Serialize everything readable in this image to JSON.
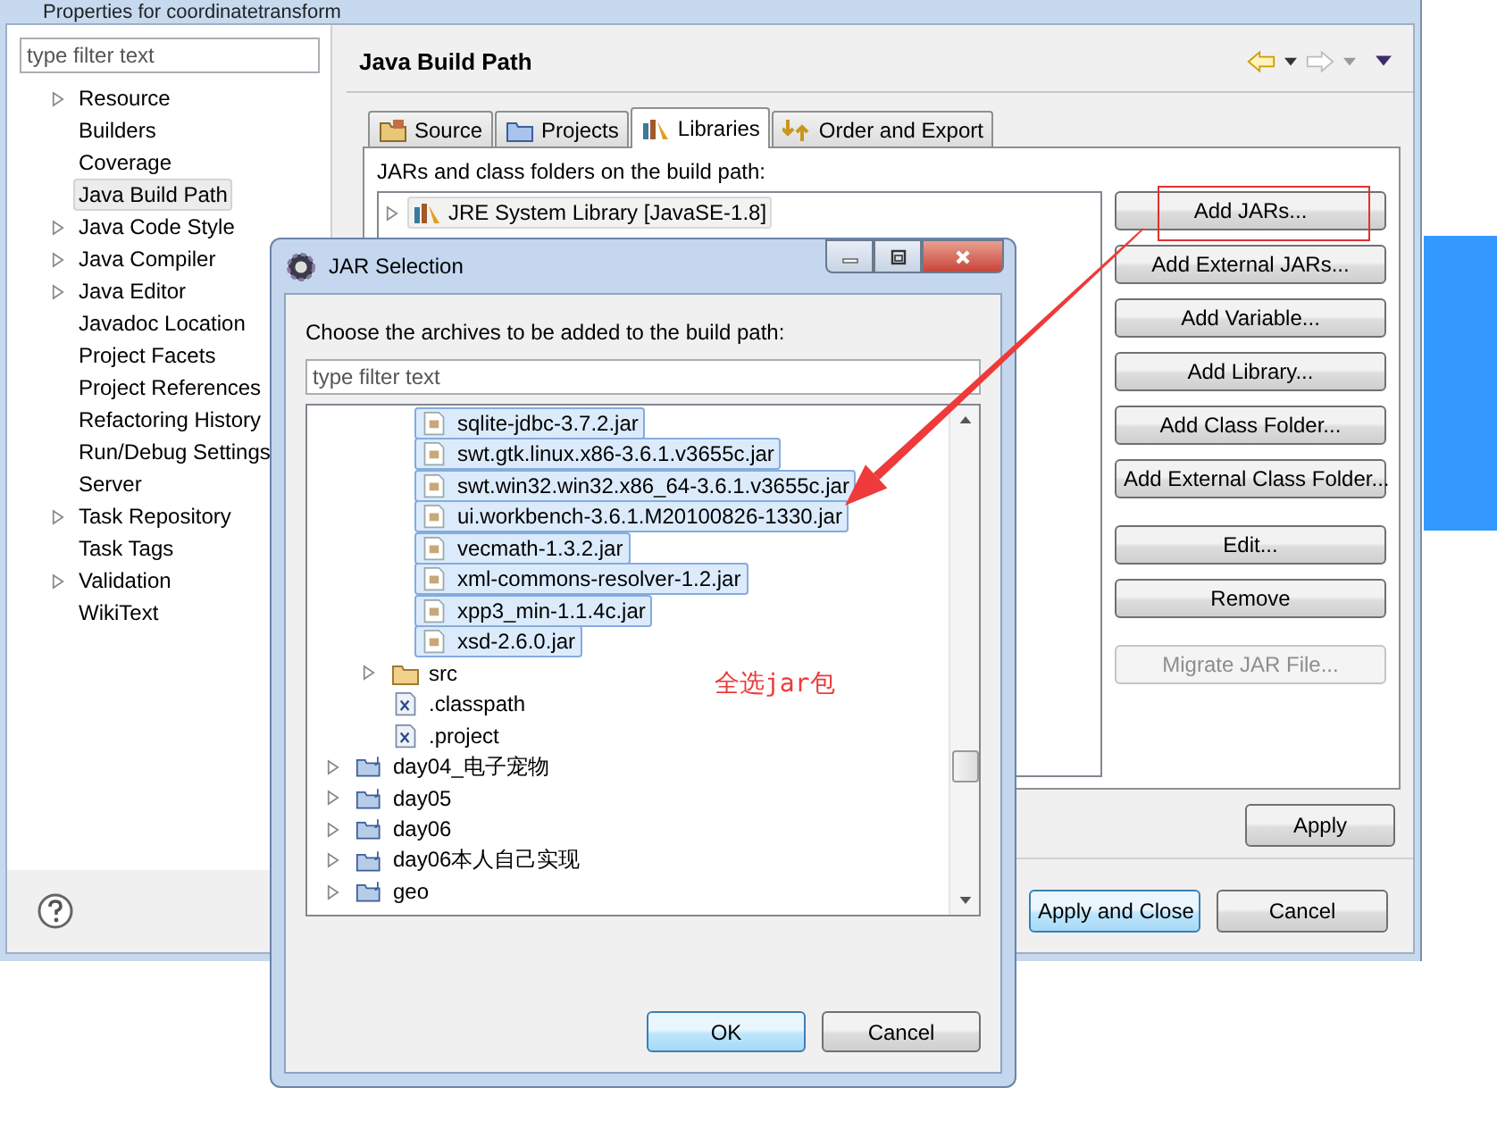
{
  "window": {
    "title": "Properties for coordinatetransform"
  },
  "sidebar": {
    "filter": {
      "placeholder": "type filter text"
    },
    "items": [
      {
        "label": "Resource",
        "expandable": true,
        "selected": false
      },
      {
        "label": "Builders",
        "expandable": false,
        "selected": false
      },
      {
        "label": "Coverage",
        "expandable": false,
        "selected": false
      },
      {
        "label": "Java Build Path",
        "expandable": false,
        "selected": true
      },
      {
        "label": "Java Code Style",
        "expandable": true,
        "selected": false
      },
      {
        "label": "Java Compiler",
        "expandable": true,
        "selected": false
      },
      {
        "label": "Java Editor",
        "expandable": true,
        "selected": false
      },
      {
        "label": "Javadoc Location",
        "expandable": false,
        "selected": false
      },
      {
        "label": "Project Facets",
        "expandable": false,
        "selected": false
      },
      {
        "label": "Project References",
        "expandable": false,
        "selected": false
      },
      {
        "label": "Refactoring History",
        "expandable": false,
        "selected": false
      },
      {
        "label": "Run/Debug Settings",
        "expandable": false,
        "selected": false
      },
      {
        "label": "Server",
        "expandable": false,
        "selected": false
      },
      {
        "label": "Task Repository",
        "expandable": true,
        "selected": false
      },
      {
        "label": "Task Tags",
        "expandable": false,
        "selected": false
      },
      {
        "label": "Validation",
        "expandable": true,
        "selected": false
      },
      {
        "label": "WikiText",
        "expandable": false,
        "selected": false
      }
    ]
  },
  "page": {
    "title": "Java Build Path",
    "tabs": [
      {
        "label": "Source",
        "kind": "source",
        "selected": false
      },
      {
        "label": "Projects",
        "kind": "projects",
        "selected": false
      },
      {
        "label": "Libraries",
        "kind": "libraries",
        "selected": true
      },
      {
        "label": "Order and Export",
        "kind": "order",
        "selected": false
      }
    ],
    "list_label": "JARs and class folders on the build path:",
    "entries": [
      {
        "label": "JRE System Library [JavaSE-1.8]",
        "selected": true
      }
    ],
    "button_groups": [
      [
        {
          "label": "Add JARs...",
          "disabled": false,
          "highlighted": true
        },
        {
          "label": "Add External JARs...",
          "disabled": false,
          "highlighted": false
        },
        {
          "label": "Add Variable...",
          "disabled": false,
          "highlighted": false
        },
        {
          "label": "Add Library...",
          "disabled": false,
          "highlighted": false
        },
        {
          "label": "Add Class Folder...",
          "disabled": false,
          "highlighted": false
        },
        {
          "label": "Add External Class Folder...",
          "disabled": false,
          "highlighted": false
        }
      ],
      [
        {
          "label": "Edit...",
          "disabled": false,
          "highlighted": false
        },
        {
          "label": "Remove",
          "disabled": false,
          "highlighted": false
        }
      ],
      [
        {
          "label": "Migrate JAR File...",
          "disabled": true,
          "highlighted": false
        }
      ]
    ],
    "apply": "Apply"
  },
  "footer": {
    "buttons": [
      {
        "label": "Apply and Close",
        "default": true
      },
      {
        "label": "Cancel",
        "default": false
      }
    ]
  },
  "dialog": {
    "title": "JAR Selection",
    "prompt": "Choose the archives to be added to the build path:",
    "filter": {
      "placeholder": "type filter text"
    },
    "tree": [
      {
        "label": "sqlite-jdbc-3.7.2.jar",
        "kind": "jar",
        "selected": true
      },
      {
        "label": "swt.gtk.linux.x86-3.6.1.v3655c.jar",
        "kind": "jar",
        "selected": true
      },
      {
        "label": "swt.win32.win32.x86_64-3.6.1.v3655c.jar",
        "kind": "jar",
        "selected": true
      },
      {
        "label": "ui.workbench-3.6.1.M20100826-1330.jar",
        "kind": "jar",
        "selected": true
      },
      {
        "label": "vecmath-1.3.2.jar",
        "kind": "jar",
        "selected": true
      },
      {
        "label": "xml-commons-resolver-1.2.jar",
        "kind": "jar",
        "selected": true
      },
      {
        "label": "xpp3_min-1.1.4c.jar",
        "kind": "jar",
        "selected": true
      },
      {
        "label": "xsd-2.6.0.jar",
        "kind": "jar",
        "selected": true
      },
      {
        "label": "src",
        "kind": "folder",
        "selected": false
      },
      {
        "label": ".classpath",
        "kind": "file",
        "selected": false
      },
      {
        "label": ".project",
        "kind": "file",
        "selected": false
      },
      {
        "label": "day04_电子宠物",
        "kind": "project",
        "selected": false
      },
      {
        "label": "day05",
        "kind": "project",
        "selected": false
      },
      {
        "label": "day06",
        "kind": "project",
        "selected": false
      },
      {
        "label": "day06本人自己实现",
        "kind": "project",
        "selected": false
      },
      {
        "label": "geo",
        "kind": "project",
        "selected": false
      }
    ],
    "buttons": [
      {
        "label": "OK",
        "default": true
      },
      {
        "label": "Cancel",
        "default": false
      }
    ]
  },
  "annotation": {
    "text": "全选jar包"
  }
}
